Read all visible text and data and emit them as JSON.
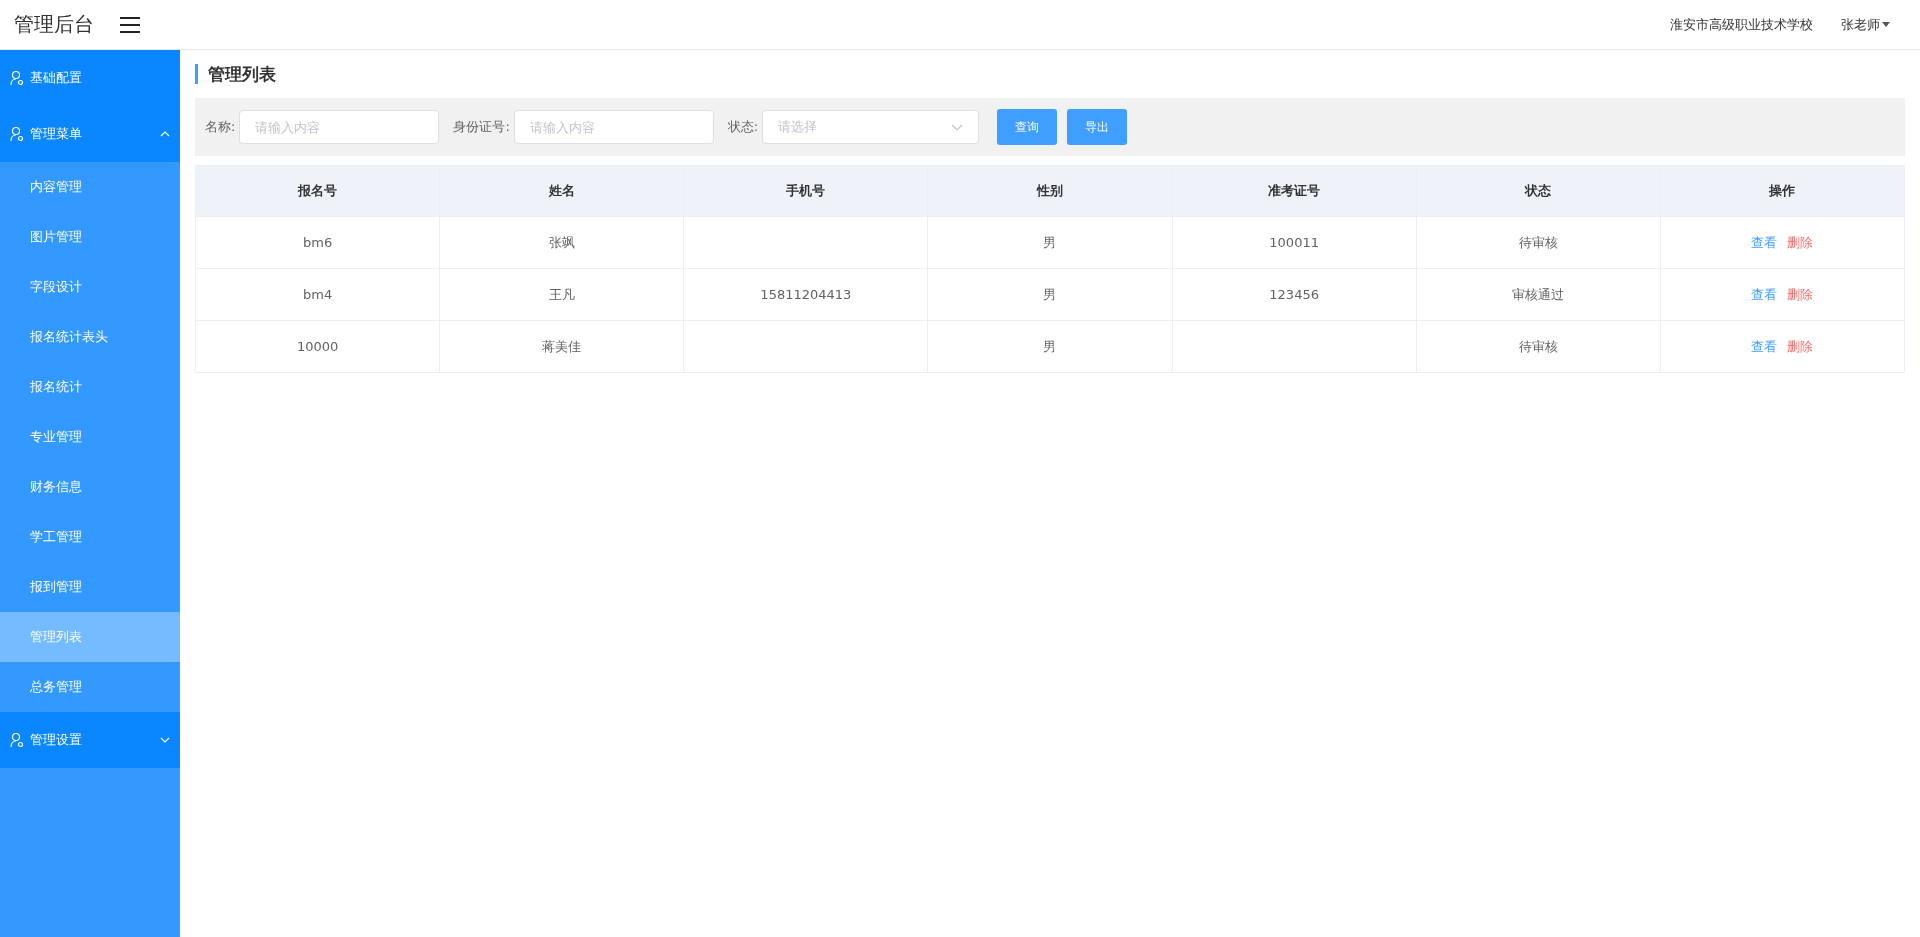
{
  "header": {
    "title": "管理后台",
    "school": "淮安市高级职业技术学校",
    "user": "张老师"
  },
  "sidebar": {
    "items": [
      {
        "kind": "link",
        "label": "基础配置"
      },
      {
        "kind": "submenu",
        "label": "管理菜单",
        "expanded": true,
        "children": [
          {
            "label": "内容管理",
            "selected": false
          },
          {
            "label": "图片管理",
            "selected": false
          },
          {
            "label": "字段设计",
            "selected": false
          },
          {
            "label": "报名统计表头",
            "selected": false
          },
          {
            "label": "报名统计",
            "selected": false
          },
          {
            "label": "专业管理",
            "selected": false
          },
          {
            "label": "财务信息",
            "selected": false
          },
          {
            "label": "学工管理",
            "selected": false
          },
          {
            "label": "报到管理",
            "selected": false
          },
          {
            "label": "管理列表",
            "selected": true
          },
          {
            "label": "总务管理",
            "selected": false
          }
        ]
      },
      {
        "kind": "submenu",
        "label": "管理设置",
        "expanded": false
      }
    ]
  },
  "page_title": "管理列表",
  "filters": [
    {
      "kind": "input",
      "label": "名称:",
      "placeholder": "请输入内容"
    },
    {
      "kind": "input",
      "label": "身份证号:",
      "placeholder": "请输入内容"
    },
    {
      "kind": "select",
      "label": "状态:",
      "placeholder": "请选择"
    }
  ],
  "buttons": [
    "查询",
    "导出"
  ],
  "table": {
    "columns": [
      "报名号",
      "姓名",
      "手机号",
      "性别",
      "准考证号",
      "状态",
      "操作"
    ],
    "rows": [
      {
        "cells": [
          "bm6",
          "张飒",
          "",
          "男",
          "100011",
          "待审核"
        ],
        "actions": [
          "查看",
          "删除"
        ]
      },
      {
        "cells": [
          "bm4",
          "王凡",
          "15811204413",
          "男",
          "123456",
          "审核通过"
        ],
        "actions": [
          "查看",
          "删除"
        ]
      },
      {
        "cells": [
          "10000",
          "蒋美佳",
          "",
          "男",
          "",
          "待审核"
        ],
        "actions": [
          "查看",
          "删除"
        ]
      }
    ]
  }
}
